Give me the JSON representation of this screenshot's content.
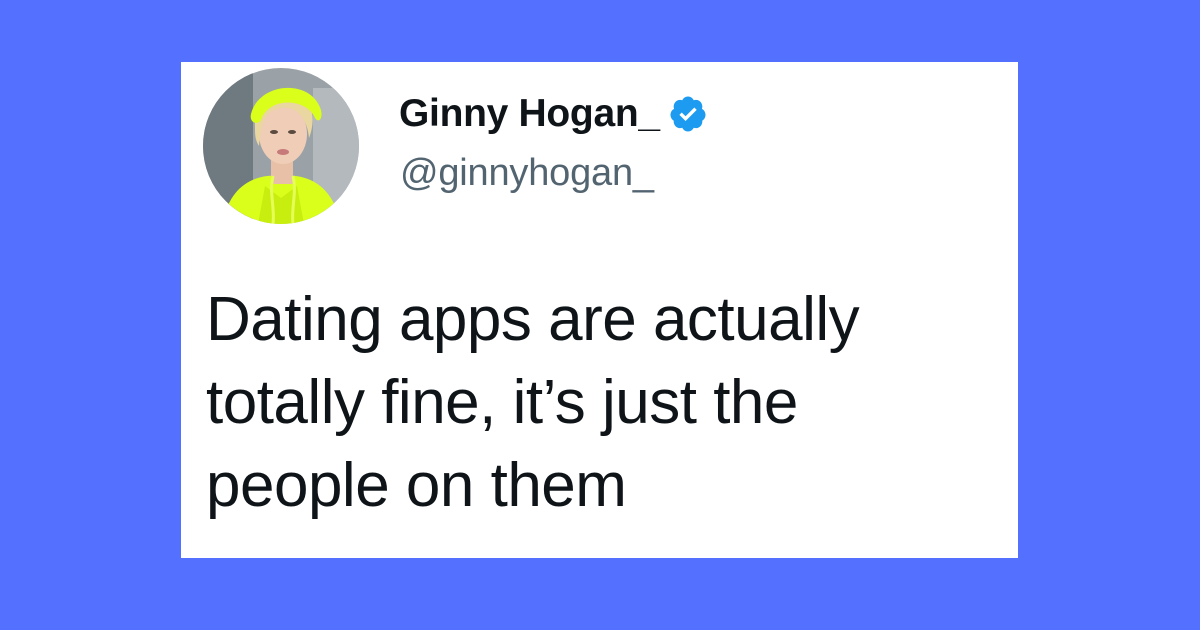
{
  "tweet": {
    "author": {
      "display_name": "Ginny Hogan_",
      "handle": "@ginnyhogan_",
      "verified_icon": "verified-badge-icon",
      "avatar_icon": "profile-avatar"
    },
    "text_lines": [
      "Dating apps are actually",
      "totally fine, it’s just the",
      "people on them"
    ]
  },
  "colors": {
    "background": "#5470ff",
    "card": "#ffffff",
    "text_primary": "#0f1419",
    "text_secondary": "#536471",
    "verified_blue": "#1d9bf0",
    "avatar_accent": "#d9ff1a"
  }
}
